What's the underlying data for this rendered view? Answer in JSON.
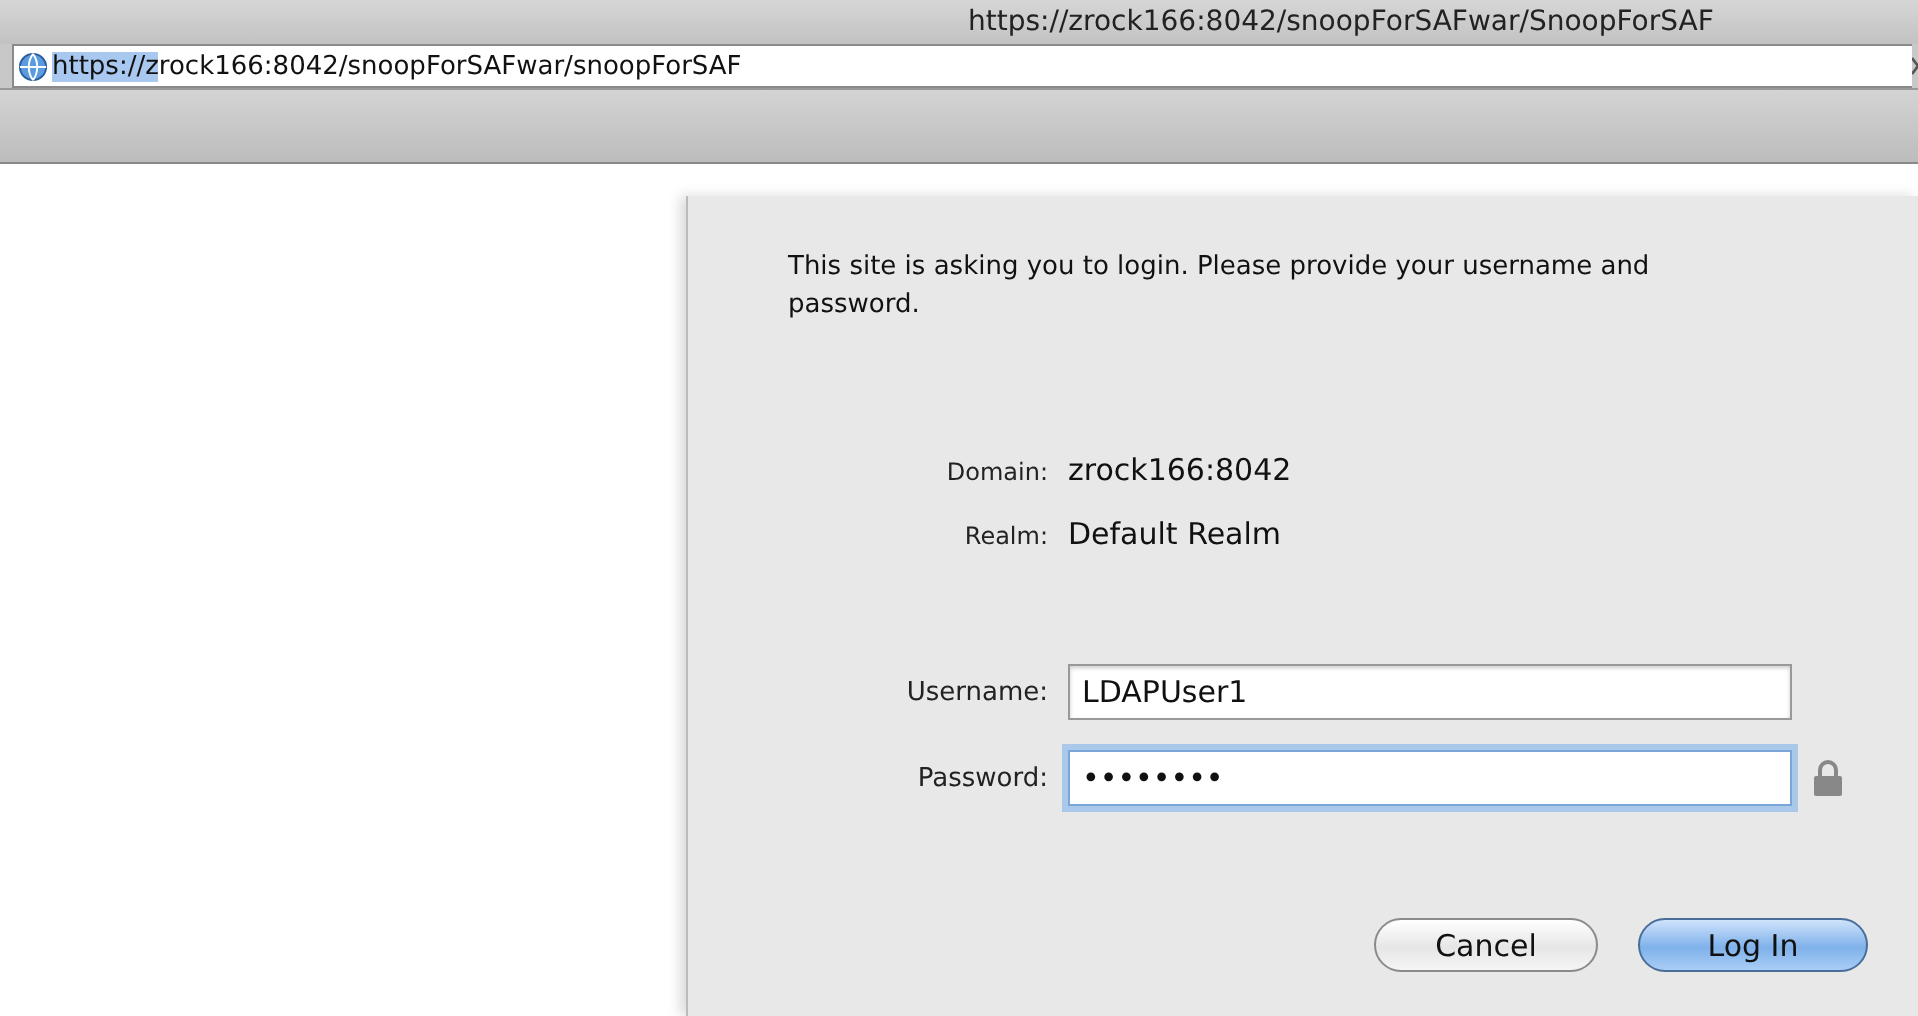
{
  "window": {
    "title": "https://zrock166:8042/snoopForSAFwar/SnoopForSAF"
  },
  "address_bar": {
    "selected_text": "https://z",
    "text": "rock166:8042/snoopForSAFwar/snoopForSAF"
  },
  "dialog": {
    "message": "This site is asking you to login. Please provide your username and password.",
    "info": [
      {
        "label": "Domain:",
        "value": "zrock166:8042"
      },
      {
        "label": "Realm:",
        "value": "Default Realm"
      }
    ],
    "fields": [
      {
        "label": "Username:",
        "value": "LDAPUser1",
        "focused": false,
        "kind": "text"
      },
      {
        "label": "Password:",
        "value": "••••••••",
        "focused": true,
        "kind": "password"
      }
    ],
    "buttons": [
      {
        "label": "Cancel",
        "default": false
      },
      {
        "label": "Log In",
        "default": true
      }
    ]
  }
}
